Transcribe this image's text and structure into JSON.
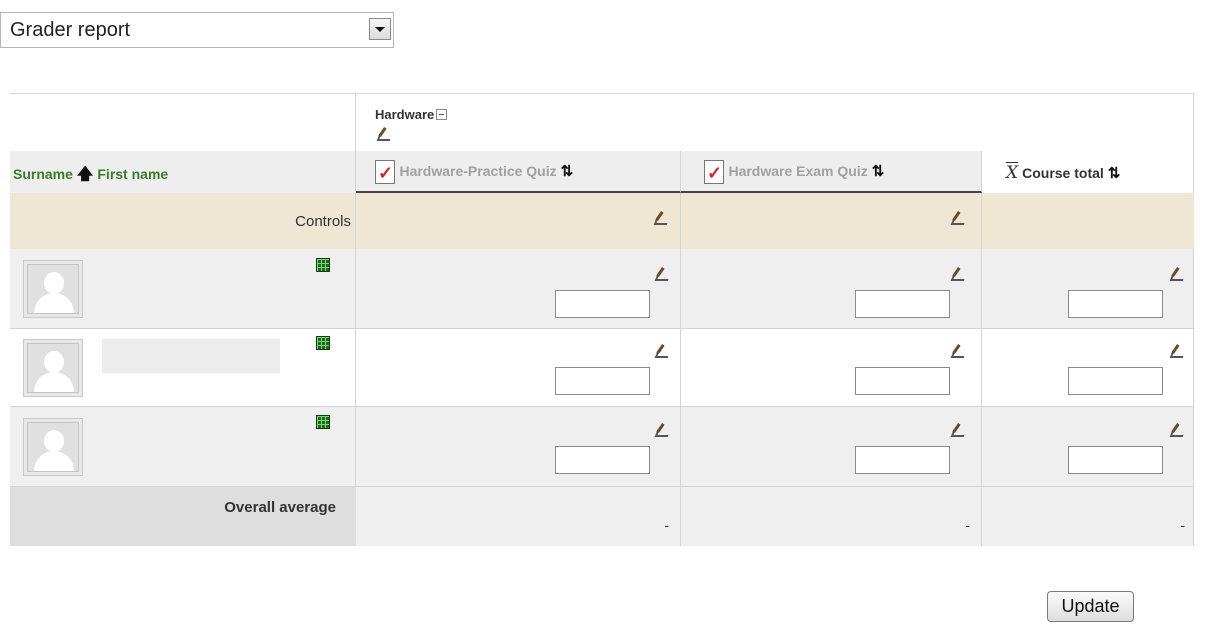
{
  "report_selector": {
    "value": "Grader report"
  },
  "table": {
    "category": "Hardware",
    "columns": {
      "name_col": {
        "surname": "Surname",
        "first_name": "First name"
      },
      "items": [
        "Hardware-Practice Quiz",
        "Hardware Exam Quiz"
      ],
      "course_total": "Course total"
    },
    "controls_label": "Controls",
    "rows": [
      {
        "grades": [
          "",
          "",
          ""
        ]
      },
      {
        "grades": [
          "",
          "",
          ""
        ]
      },
      {
        "grades": [
          "",
          "",
          ""
        ]
      }
    ],
    "overall_average": {
      "label": "Overall average",
      "values": [
        "-",
        "-",
        "-"
      ]
    }
  },
  "update_button": {
    "label": "Update"
  },
  "colors": {
    "controls_bg": "#efe6d4",
    "row_bg": "#efefef",
    "average_label_bg": "#dedede",
    "link_green": "#3a7c2a"
  },
  "icons": [
    "chevron-down-icon",
    "collapse-icon",
    "edit-icon",
    "quiz-icon",
    "sort-icon",
    "up-arrow-icon",
    "mean-icon",
    "grade-analysis-icon",
    "avatar-icon"
  ]
}
